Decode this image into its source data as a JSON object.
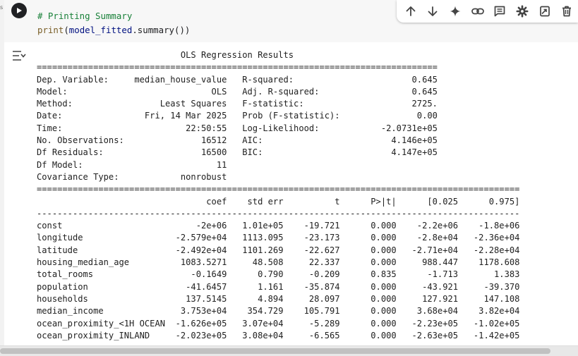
{
  "gutter": {
    "label": "s"
  },
  "code": {
    "comment": "# Printing Summary",
    "func": "print",
    "paren_open": "(",
    "var": "model_fitted",
    "method": ".summary()",
    "paren_close": ")"
  },
  "toolbar": {
    "buttons": [
      "move-up",
      "move-down",
      "sparkle",
      "link",
      "comment",
      "settings",
      "mirror",
      "delete"
    ]
  },
  "output_lines": [
    "                            OLS Regression Results                            ",
    "==============================================================================",
    "Dep. Variable:     median_house_value   R-squared:                       0.645",
    "Model:                            OLS   Adj. R-squared:                  0.645",
    "Method:                 Least Squares   F-statistic:                     2725.",
    "Date:                Fri, 14 Mar 2025   Prob (F-statistic):               0.00",
    "Time:                        22:50:55   Log-Likelihood:            -2.0731e+05",
    "No. Observations:               16512   AIC:                         4.146e+05",
    "Df Residuals:                   16500   BIC:                         4.147e+05",
    "Df Model:                          11                                         ",
    "Covariance Type:            nonrobust                                         ",
    "==============================================================================================",
    "                                 coef    std err          t      P>|t|      [0.025      0.975]",
    "----------------------------------------------------------------------------------------------",
    "const                          -2e+06   1.01e+05    -19.721      0.000    -2.2e+06    -1.8e+06",
    "longitude                  -2.579e+04   1113.095    -23.173      0.000    -2.8e+04   -2.36e+04",
    "latitude                   -2.492e+04   1101.269    -22.627      0.000   -2.71e+04   -2.28e+04",
    "housing_median_age          1083.5271     48.508     22.337      0.000     988.447    1178.608",
    "total_rooms                   -0.1649      0.790     -0.209      0.835      -1.713       1.383",
    "population                   -41.6457      1.161    -35.874      0.000     -43.921     -39.370",
    "households                   137.5145      4.894     28.097      0.000     127.921     147.108",
    "median_income               3.753e+04    354.729    105.791      0.000    3.68e+04    3.82e+04",
    "ocean_proximity_<1H OCEAN  -1.626e+05   3.07e+04     -5.289      0.000   -2.23e+05   -1.02e+05",
    "ocean_proximity_INLAND     -2.023e+05   3.08e+04     -6.565      0.000   -2.63e+05   -1.42e+05"
  ]
}
